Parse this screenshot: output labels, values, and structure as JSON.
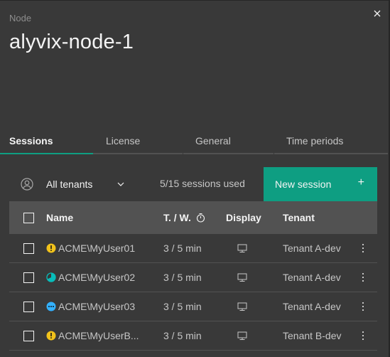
{
  "header": {
    "label": "Node",
    "title": "alyvix-node-1",
    "close_icon": "close-icon"
  },
  "tabs": [
    {
      "label": "Sessions",
      "active": true
    },
    {
      "label": "License",
      "active": false
    },
    {
      "label": "General",
      "active": false
    },
    {
      "label": "Time periods",
      "active": false
    }
  ],
  "toolbar": {
    "tenant_filter": {
      "icon": "user-avatar-icon",
      "selected": "All tenants"
    },
    "sessions_used": "5/15 sessions used",
    "new_session_label": "New session",
    "new_session_icon": "+"
  },
  "table": {
    "columns": {
      "name": "Name",
      "tw": "T. / W.",
      "tw_icon": "timer-icon",
      "display": "Display",
      "tenant": "Tenant"
    },
    "rows": [
      {
        "status": "warning",
        "name": "ACME\\MyUser01",
        "tw": "3 / 5 min",
        "display_icon": "monitor-icon",
        "tenant": "Tenant A-dev"
      },
      {
        "status": "in-progress",
        "name": "ACME\\MyUser02",
        "tw": "3 / 5 min",
        "display_icon": "monitor-icon",
        "tenant": "Tenant A-dev"
      },
      {
        "status": "pending",
        "name": "ACME\\MyUser03",
        "tw": "3 / 5 min",
        "display_icon": "monitor-icon",
        "tenant": "Tenant A-dev"
      },
      {
        "status": "warning",
        "name": "ACME\\MyUserB...",
        "tw": "3 / 5 min",
        "display_icon": "monitor-icon",
        "tenant": "Tenant B-dev"
      }
    ]
  },
  "colors": {
    "accent": "#0e9e82",
    "warning": "#f1c21b",
    "in_progress": "#08bdba",
    "pending": "#4589ff",
    "background": "#393939",
    "header_row": "#525252"
  }
}
